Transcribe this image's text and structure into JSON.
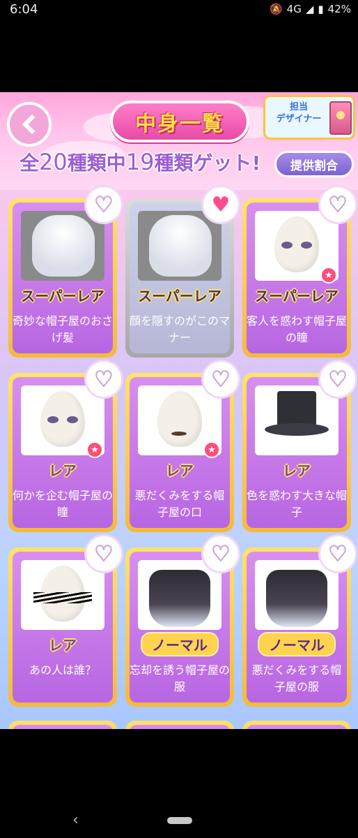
{
  "status_bar": {
    "time": "6:04",
    "network": "4G",
    "battery": "42%"
  },
  "header": {
    "title": "中身一覧",
    "designer_button_label": "担当\nデザイナー",
    "count_prefix": "全",
    "count_total": "20",
    "count_mid": "種類中",
    "count_got": "19",
    "count_suffix": "種類ゲット!",
    "rate_button": "提供割合"
  },
  "items": [
    {
      "name": "奇妙な帽子屋のおさげ髪",
      "rarity": "スーパーレア",
      "owned": true,
      "favorite": false,
      "star": false,
      "kind": "hair"
    },
    {
      "name": "顔を隠すのがこのマナー",
      "rarity": "スーパーレア",
      "owned": false,
      "favorite": true,
      "star": false,
      "kind": "hair-dark"
    },
    {
      "name": "客人を惑わす帽子屋の瞳",
      "rarity": "スーパーレア",
      "owned": true,
      "favorite": false,
      "star": true,
      "kind": "eyes"
    },
    {
      "name": "何かを企む帽子屋の瞳",
      "rarity": "レア",
      "owned": true,
      "favorite": false,
      "star": true,
      "kind": "eyes"
    },
    {
      "name": "悪だくみをする帽子屋の口",
      "rarity": "レア",
      "owned": true,
      "favorite": false,
      "star": true,
      "kind": "mouth"
    },
    {
      "name": "色を惑わす大きな帽子",
      "rarity": "レア",
      "owned": true,
      "favorite": false,
      "star": false,
      "kind": "hat"
    },
    {
      "name": "あの人は誰？",
      "rarity": "レア",
      "owned": true,
      "favorite": false,
      "star": false,
      "kind": "scribble"
    },
    {
      "name": "忘却を誘う帽子屋の服",
      "rarity": "ノーマル",
      "owned": true,
      "favorite": false,
      "star": false,
      "kind": "outfit"
    },
    {
      "name": "悪だくみをする帽子屋の服",
      "rarity": "ノーマル",
      "owned": true,
      "favorite": false,
      "star": false,
      "kind": "outfit"
    }
  ],
  "colors": {
    "card_border": "#f5b93a",
    "card_owned": "#c37be8",
    "card_missing": "#b5b7d5",
    "title_text": "#ffe040",
    "heart_active": "#ff4d8f",
    "count_text": "#9b5ed3"
  },
  "icons": {
    "back": "chevron-left-icon",
    "favorite": "heart-icon",
    "star_badge": "star-icon"
  }
}
